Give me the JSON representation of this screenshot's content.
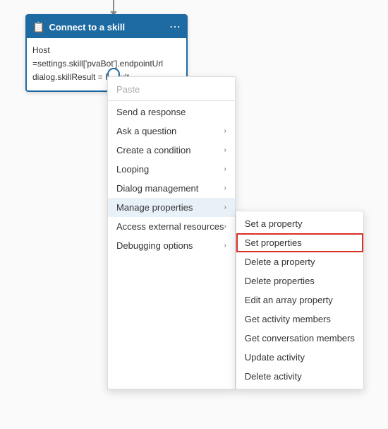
{
  "node": {
    "title": "Connect to a skill",
    "icon": "📋",
    "body_line1": "Host =settings.skill['pvaBot'].endpointUrl",
    "body_line2": "dialog.skillResult = Result"
  },
  "contextMenu": {
    "items": [
      {
        "label": "Paste",
        "icon": "📋",
        "disabled": true,
        "hasSubmenu": false
      },
      {
        "label": "Send a response",
        "disabled": false,
        "hasSubmenu": false
      },
      {
        "label": "Ask a question",
        "disabled": false,
        "hasSubmenu": true
      },
      {
        "label": "Create a condition",
        "disabled": false,
        "hasSubmenu": true
      },
      {
        "label": "Looping",
        "disabled": false,
        "hasSubmenu": true
      },
      {
        "label": "Dialog management",
        "disabled": false,
        "hasSubmenu": true
      },
      {
        "label": "Manage properties",
        "disabled": false,
        "hasSubmenu": true,
        "active": true
      },
      {
        "label": "Access external resources",
        "disabled": false,
        "hasSubmenu": true
      },
      {
        "label": "Debugging options",
        "disabled": false,
        "hasSubmenu": true
      }
    ]
  },
  "submenu": {
    "items": [
      {
        "label": "Set a property",
        "highlighted": false
      },
      {
        "label": "Set properties",
        "highlighted": true
      },
      {
        "label": "Delete a property",
        "highlighted": false
      },
      {
        "label": "Delete properties",
        "highlighted": false
      },
      {
        "label": "Edit an array property",
        "highlighted": false
      },
      {
        "label": "Get activity members",
        "highlighted": false
      },
      {
        "label": "Get conversation members",
        "highlighted": false
      },
      {
        "label": "Update activity",
        "highlighted": false
      },
      {
        "label": "Delete activity",
        "highlighted": false
      }
    ]
  }
}
